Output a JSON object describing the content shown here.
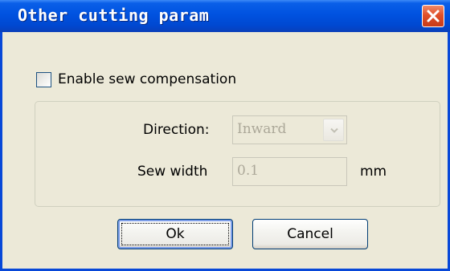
{
  "window": {
    "title": "Other cutting param"
  },
  "titlebar": {
    "close_icon": "close-icon"
  },
  "options": {
    "enable_sew_compensation": {
      "label": "Enable sew compensation",
      "checked": false
    }
  },
  "fields": {
    "direction": {
      "label": "Direction:",
      "value": "Inward",
      "enabled": false
    },
    "sew_width": {
      "label": "Sew width",
      "value": "0.1",
      "unit": "mm",
      "enabled": false
    }
  },
  "buttons": {
    "ok": "Ok",
    "cancel": "Cancel"
  },
  "colors": {
    "titlebar": "#0052e0",
    "window_bg": "#ece9d8",
    "close_button": "#e0502a",
    "disabled_text": "#aca899"
  }
}
